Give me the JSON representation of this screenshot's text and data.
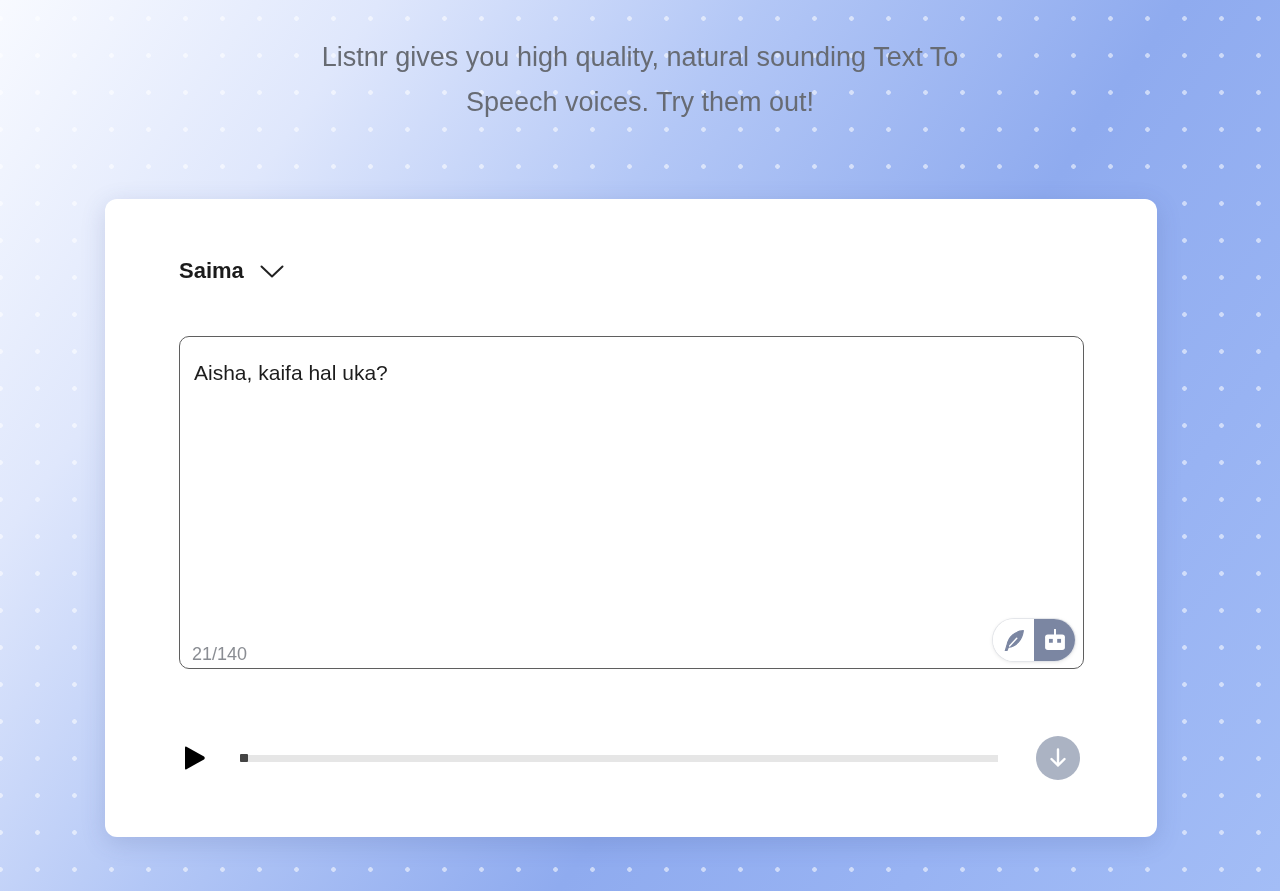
{
  "intro": {
    "text": "Listnr gives you high quality, natural sounding Text To Speech voices. Try them out!"
  },
  "voice_select": {
    "value": "Saima"
  },
  "editor": {
    "value": "Aisha, kaifa hal uka?",
    "counter": "21/140",
    "modes": [
      {
        "kind": "feather",
        "selected": false
      },
      {
        "kind": "robot",
        "selected": true
      }
    ]
  },
  "player": {
    "level": 0,
    "download": {
      "disabled": true
    }
  }
}
